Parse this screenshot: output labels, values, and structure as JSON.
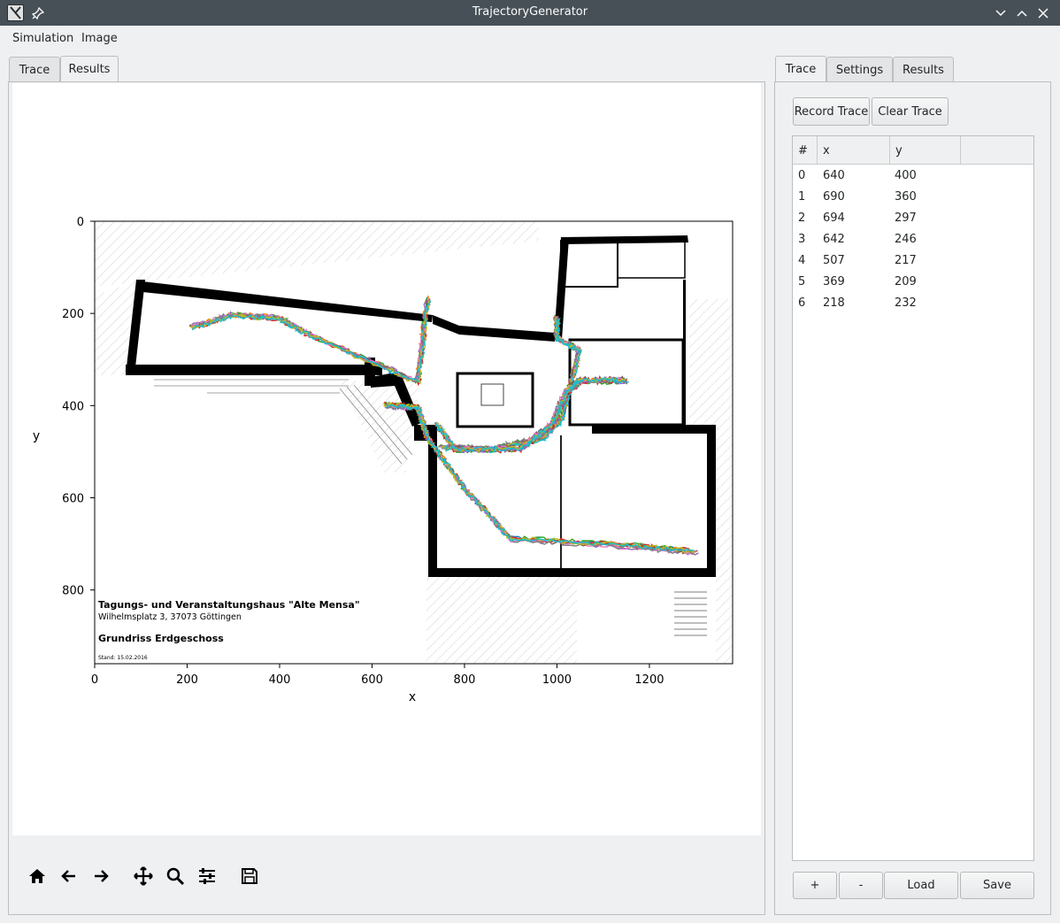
{
  "window": {
    "title": "TrajectoryGenerator"
  },
  "menu": {
    "items": [
      "Simulation",
      "Image"
    ]
  },
  "left_tabs": [
    {
      "label": "Trace"
    },
    {
      "label": "Results"
    }
  ],
  "right_tabs": [
    {
      "label": "Trace"
    },
    {
      "label": "Settings"
    },
    {
      "label": "Results"
    }
  ],
  "trace_buttons": {
    "record": "Record Trace",
    "clear": "Clear Trace"
  },
  "trace_table": {
    "headers": [
      "#",
      "x",
      "y"
    ],
    "rows": [
      {
        "i": "0",
        "x": "640",
        "y": "400"
      },
      {
        "i": "1",
        "x": "690",
        "y": "360"
      },
      {
        "i": "2",
        "x": "694",
        "y": "297"
      },
      {
        "i": "3",
        "x": "642",
        "y": "246"
      },
      {
        "i": "4",
        "x": "507",
        "y": "217"
      },
      {
        "i": "5",
        "x": "369",
        "y": "209"
      },
      {
        "i": "6",
        "x": "218",
        "y": "232"
      }
    ]
  },
  "bottom_buttons": {
    "add": "+",
    "remove": "-",
    "load": "Load",
    "save": "Save"
  },
  "toolbar_icons": [
    "home-icon",
    "back-arrow-icon",
    "forward-arrow-icon",
    "pan-icon",
    "zoom-icon",
    "configure-subplots-icon",
    "save-icon"
  ],
  "floorplan_text": {
    "line1": "Tagungs- und Veranstaltungshaus \"Alte Mensa\"",
    "line2": "Wilhelmsplatz 3, 37073 Göttingen",
    "line3": "Grundriss Erdgeschoss",
    "line4": "Stand: 15.02.2016"
  },
  "chart_data": {
    "type": "line",
    "xlabel": "x",
    "ylabel": "y",
    "xlim": [
      0,
      1380
    ],
    "ylim": [
      960,
      0
    ],
    "xticks": [
      0,
      200,
      400,
      600,
      800,
      1000,
      1200
    ],
    "yticks": [
      0,
      200,
      400,
      600,
      800
    ],
    "series_colors": [
      "#1f77b4",
      "#ff7f0e",
      "#2ca02c",
      "#d62728",
      "#9467bd",
      "#8c564b",
      "#e377c2",
      "#7f7f7f",
      "#bcbd22",
      "#17becf"
    ],
    "trajectories": [
      {
        "points": [
          [
            210,
            232
          ],
          [
            300,
            205
          ],
          [
            400,
            212
          ],
          [
            470,
            250
          ],
          [
            700,
            350
          ],
          [
            722,
            170
          ]
        ]
      },
      {
        "points": [
          [
            1300,
            718
          ],
          [
            1150,
            705
          ],
          [
            900,
            690
          ],
          [
            800,
            580
          ],
          [
            720,
            470
          ],
          [
            700,
            405
          ],
          [
            630,
            400
          ]
        ]
      },
      {
        "points": [
          [
            750,
            490
          ],
          [
            860,
            495
          ],
          [
            970,
            470
          ],
          [
            1010,
            430
          ],
          [
            1050,
            280
          ],
          [
            1000,
            255
          ],
          [
            1000,
            210
          ]
        ]
      },
      {
        "points": [
          [
            1150,
            345
          ],
          [
            1050,
            345
          ],
          [
            1020,
            370
          ],
          [
            990,
            440
          ],
          [
            920,
            493
          ],
          [
            780,
            495
          ],
          [
            740,
            440
          ]
        ]
      }
    ]
  }
}
